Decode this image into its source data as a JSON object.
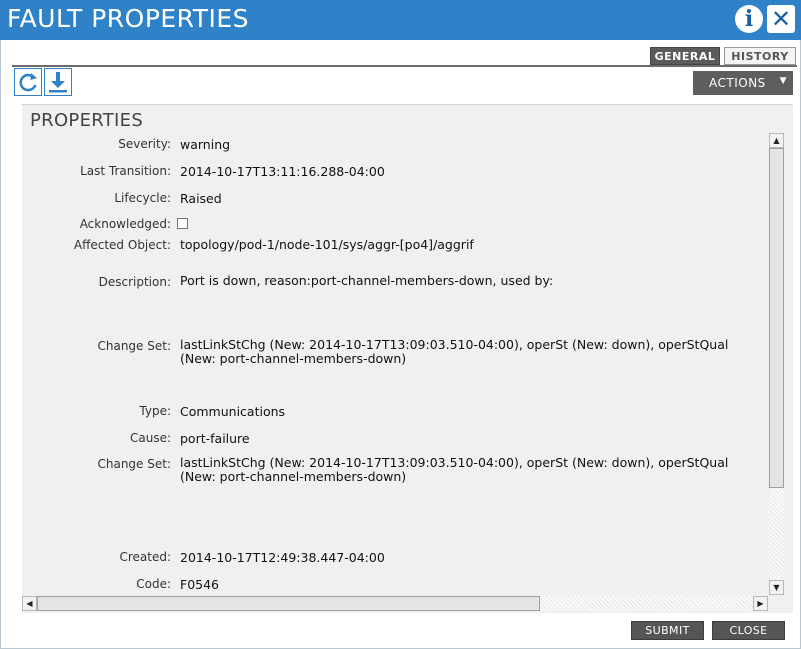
{
  "window": {
    "title": "FAULT PROPERTIES",
    "info_glyph": "i",
    "close_glyph": "✕"
  },
  "tabs": [
    {
      "label": "GENERAL",
      "active": true
    },
    {
      "label": "HISTORY",
      "active": false
    }
  ],
  "toolbar": {
    "refresh_icon": "refresh-icon",
    "download_icon": "download-icon",
    "actions_label": "ACTIONS"
  },
  "panel": {
    "title": "PROPERTIES",
    "fields": {
      "severity": {
        "label": "Severity:",
        "value": "warning"
      },
      "last_transition": {
        "label": "Last Transition:",
        "value": "2014-10-17T13:11:16.288-04:00"
      },
      "lifecycle": {
        "label": "Lifecycle:",
        "value": "Raised"
      },
      "acknowledged": {
        "label": "Acknowledged:",
        "checked": false
      },
      "affected_object": {
        "label": "Affected Object:",
        "value": "topology/pod-1/node-101/sys/aggr-[po4]/aggrif"
      },
      "description": {
        "label": "Description:",
        "value": "Port is down, reason:port-channel-members-down, used by:"
      },
      "change_set_1": {
        "label": "Change Set:",
        "line1": "lastLinkStChg (New: 2014-10-17T13:09:03.510-04:00), operSt (New: down), operStQual",
        "line2": "(New: port-channel-members-down)"
      },
      "type": {
        "label": "Type:",
        "value": "Communications"
      },
      "cause": {
        "label": "Cause:",
        "value": "port-failure"
      },
      "change_set_2": {
        "label": "Change Set:",
        "line1": "lastLinkStChg (New: 2014-10-17T13:09:03.510-04:00), operSt (New: down), operStQual",
        "line2": "(New: port-channel-members-down)"
      },
      "created": {
        "label": "Created:",
        "value": "2014-10-17T12:49:38.447-04:00"
      },
      "code": {
        "label": "Code:",
        "value": "F0546"
      }
    }
  },
  "footer": {
    "submit_label": "SUBMIT",
    "close_label": "CLOSE"
  },
  "colors": {
    "titlebar": "#2f82c7",
    "panel_bg": "#f0f0f0",
    "button_bg": "#555555"
  }
}
